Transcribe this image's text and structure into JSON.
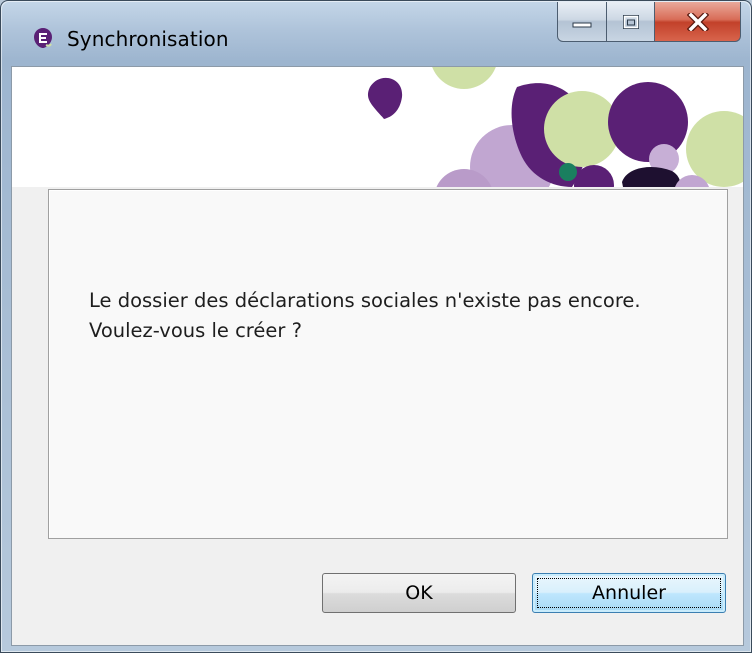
{
  "window": {
    "title": "Synchronisation",
    "app_icon": "app-logo-icon",
    "caption_buttons": {
      "minimize_icon": "minimize-icon",
      "maximize_icon": "maximize-icon",
      "close_icon": "close-icon"
    }
  },
  "dialog": {
    "message_line1": "Le dossier des déclarations sociales n'existe pas encore.",
    "message_line2": "Voulez-vous le créer ?",
    "ok_label": "OK",
    "cancel_label": "Annuler"
  },
  "colors": {
    "brand_purple": "#5a2075",
    "brand_lilac": "#b99bc9",
    "brand_green_light": "#cfe0a6",
    "brand_teal": "#1a7f5f",
    "brand_dark": "#1e1030",
    "close_button_red": "#c2412a",
    "default_button_blue": "#3c7fb1"
  }
}
